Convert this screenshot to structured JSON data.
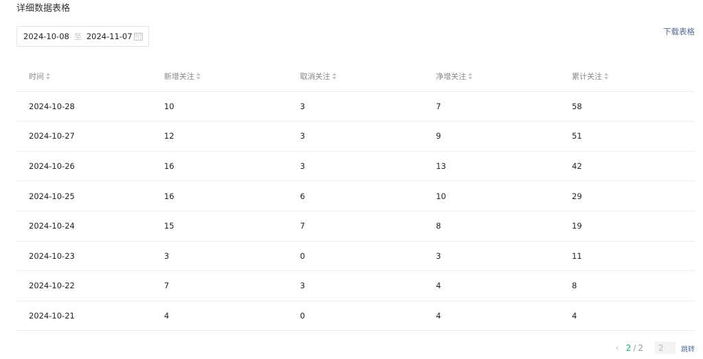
{
  "section_title": "详细数据表格",
  "date_range": {
    "start": "2024-10-08",
    "separator": "至",
    "end": "2024-11-07",
    "icon": "calendar-icon"
  },
  "download_label": "下载表格",
  "table": {
    "headers": [
      "时间",
      "新增关注",
      "取消关注",
      "净增关注",
      "累计关注"
    ],
    "rows": [
      [
        "2024-10-28",
        "10",
        "3",
        "7",
        "58"
      ],
      [
        "2024-10-27",
        "12",
        "3",
        "9",
        "51"
      ],
      [
        "2024-10-26",
        "16",
        "3",
        "13",
        "42"
      ],
      [
        "2024-10-25",
        "16",
        "6",
        "10",
        "29"
      ],
      [
        "2024-10-24",
        "15",
        "7",
        "8",
        "19"
      ],
      [
        "2024-10-23",
        "3",
        "0",
        "3",
        "11"
      ],
      [
        "2024-10-22",
        "7",
        "3",
        "4",
        "8"
      ],
      [
        "2024-10-21",
        "4",
        "0",
        "4",
        "4"
      ]
    ]
  },
  "pagination": {
    "prev_icon": "‹",
    "current": "2",
    "slash": "/",
    "total": "2",
    "goto_value": "2",
    "goto_label": "跳转"
  },
  "colors": {
    "accent_link": "#576b95",
    "current_page": "#07c160"
  }
}
